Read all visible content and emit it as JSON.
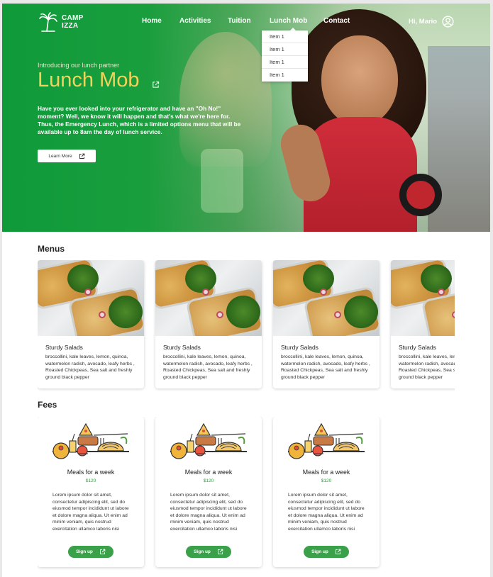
{
  "brand": {
    "name_line1": "CAMP",
    "name_line2": "IZZA"
  },
  "nav": {
    "items": [
      "Home",
      "Activities",
      "Tuition",
      "Lunch Mob",
      "Contact"
    ],
    "active": "Lunch Mob",
    "dropdown": [
      "Item 1",
      "Item 1",
      "Item 1",
      "Item 1"
    ]
  },
  "user": {
    "greeting": "Hi, Mario"
  },
  "hero": {
    "intro": "Introducing our lunch partner",
    "title": "Lunch Mob",
    "body": "Have you ever looked into your refrigerator and have an \"Oh No!\" moment? Well, we know it will happen and that's what we're here for. Thus, the Emergency Lunch, which is a limited options menu that will be available up to 8am the day of lunch service.",
    "cta": "Learn More"
  },
  "menus": {
    "title": "Menus",
    "cards": [
      {
        "name": "Sturdy Salads",
        "desc": "broccollini, kale leaves, lemon, quinoa, watermelon radish, avocado, leafy herbs , Roasted Chickpeas, Sea salt and freshly ground black pepper"
      },
      {
        "name": "Sturdy Salads",
        "desc": "broccollini, kale leaves, lemon, quinoa, watermelon radish, avocado, leafy herbs , Roasted Chickpeas, Sea salt and freshly ground black pepper"
      },
      {
        "name": "Sturdy Salads",
        "desc": "broccollini, kale leaves, lemon, quinoa, watermelon radish, avocado, leafy herbs , Roasted Chickpeas, Sea salt and freshly ground black pepper"
      },
      {
        "name": "Sturdy Salads",
        "desc": "broccollini, kale leaves, lemon, quinoa, watermelon radish, avocado, leafy herbs , Roasted Chickpeas, Sea salt and freshly ground black pepper"
      }
    ]
  },
  "fees": {
    "title": "Fees",
    "cards": [
      {
        "name": "Meals for a week",
        "price": "$120",
        "desc": "Lorem ipsum dolor sit amet, consectetur adipiscing elit, sed do eiusmod tempor incididunt ut labore et dolore magna aliqua. Ut enim ad minim veniam, quis nostrud exercitation ullamco laboris nisi",
        "cta": "Sign up"
      },
      {
        "name": "Meals for a week",
        "price": "$120",
        "desc": "Lorem ipsum dolor sit amet, consectetur adipiscing elit, sed do eiusmod tempor incididunt ut labore et dolore magna aliqua. Ut enim ad minim veniam, quis nostrud exercitation ullamco laboris nisi",
        "cta": "Sign up"
      },
      {
        "name": "Meals for a week",
        "price": "$120",
        "desc": "Lorem ipsum dolor sit amet, consectetur adipiscing elit, sed do eiusmod tempor incididunt ut labore et dolore magna aliqua. Ut enim ad minim veniam, quis nostrud exercitation ullamco laboris nisi",
        "cta": "Sign up"
      }
    ]
  },
  "colors": {
    "brand_green": "#1a9e3d",
    "title_yellow": "#f1d35b",
    "button_green": "#3aa04a",
    "price_green": "#2e9c3e"
  },
  "icons": {
    "logo": "palm-tree-icon",
    "user": "user-circle-icon",
    "external": "external-link-icon",
    "fee_illustration": "meal-illustration"
  }
}
